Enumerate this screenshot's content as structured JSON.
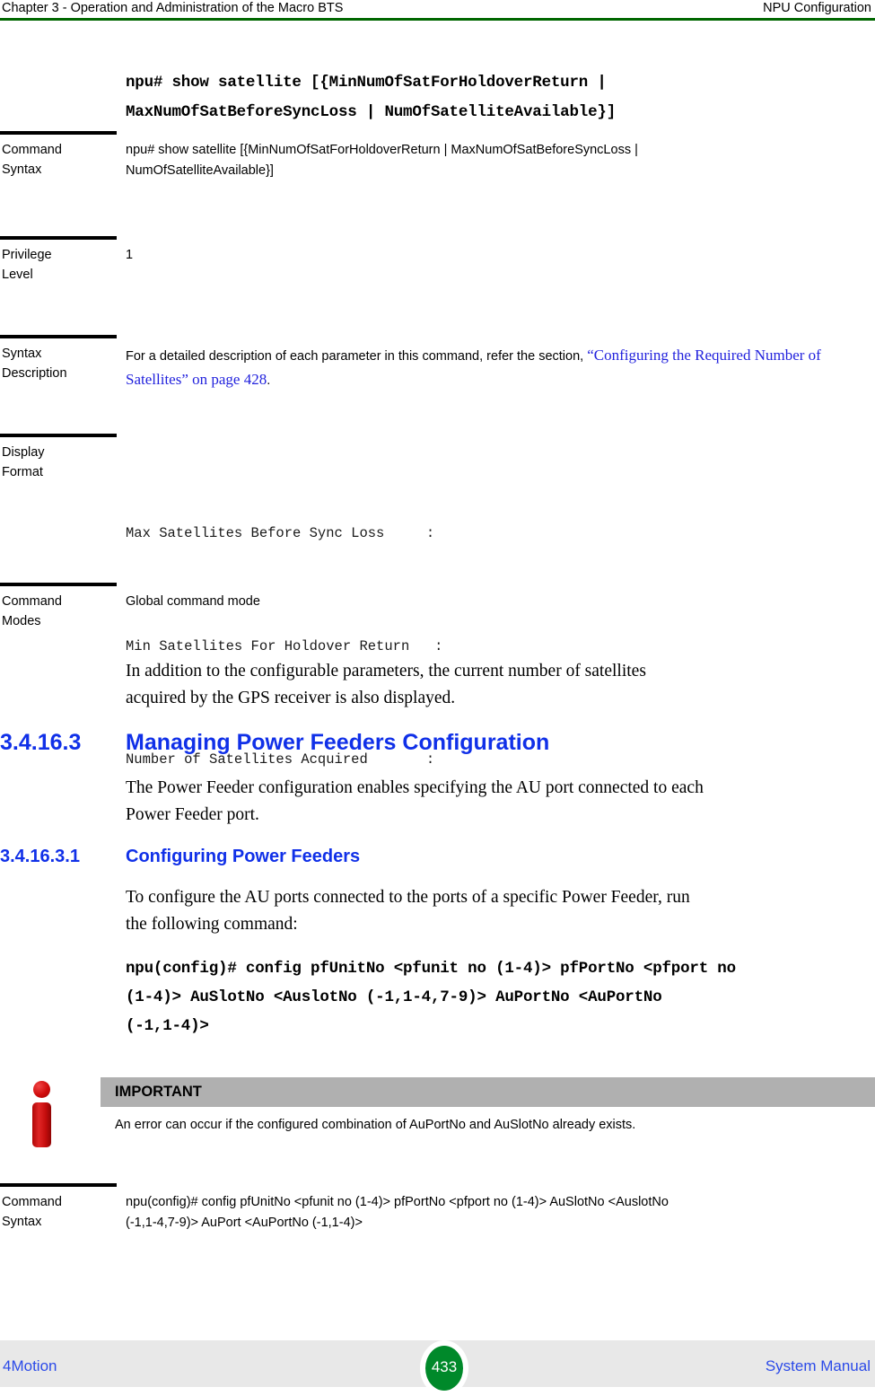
{
  "header": {
    "left": "Chapter 3 - Operation and Administration of the Macro BTS",
    "right": "NPU Configuration",
    "rule_color": "#006600"
  },
  "command_block_top": {
    "line1": "npu# show satellite [{MinNumOfSatForHoldoverReturn |",
    "line2": "MaxNumOfSatBeforeSyncLoss | NumOfSatelliteAvailable}]"
  },
  "table_show_satellite": {
    "rows": [
      {
        "label_line1": "Command",
        "label_line2": "Syntax",
        "value_line1": "npu#   show satellite [{MinNumOfSatForHoldoverReturn | MaxNumOfSatBeforeSyncLoss |",
        "value_line2": "NumOfSatelliteAvailable}]"
      },
      {
        "label_line1": "Privilege",
        "label_line2": "Level",
        "value_line1": "1",
        "value_line2": ""
      },
      {
        "label_line1": "Syntax",
        "label_line2": "Description",
        "desc_prefix": "For a detailed description of each parameter in this command, refer the section, ",
        "desc_link_line1": "“Configuring",
        "desc_link_line2": "the Required Number of Satellites” on page 428",
        "desc_suffix": "."
      },
      {
        "label_line1": "Display",
        "label_line2": "Format",
        "display_lines": [
          "Max Satellites Before Sync Loss     :",
          "Min Satellites For Holdover Return   :",
          "Number of Satellites Acquired       :"
        ]
      },
      {
        "label_line1": "Command",
        "label_line2": "Modes",
        "value_line1": "Global command mode",
        "value_line2": ""
      }
    ]
  },
  "paragraph_satellites": {
    "line1": "In addition to the configurable parameters, the current number of satellites",
    "line2": "acquired by the GPS receiver is also displayed."
  },
  "heading_3_4_16_3": {
    "number": "3.4.16.3",
    "text": "Managing Power Feeders Configuration",
    "color": "#1030e8"
  },
  "paragraph_power_feeder": {
    "line1": "The Power Feeder configuration enables specifying the AU port connected to each",
    "line2": "Power Feeder port."
  },
  "heading_3_4_16_3_1": {
    "number": "3.4.16.3.1",
    "text": "Configuring Power Feeders",
    "color": "#1030e8"
  },
  "paragraph_configure": {
    "line1": "To configure the AU ports connected to the ports of a specific Power Feeder, run",
    "line2": "the following command:"
  },
  "command_block_config": {
    "line1": "npu(config)# config pfUnitNo <pfunit no (1-4)> pfPortNo <pfport no",
    "line2": "(1-4)> AuSlotNo <AuslotNo (-1,1-4,7-9)> AuPortNo <AuPortNo",
    "line3": "(-1,1-4)>"
  },
  "important_callout": {
    "icon": "info-icon",
    "banner_label": "IMPORTANT",
    "banner_color": "#b0b0b0",
    "body": "An error can occur if the configured combination of AuPortNo and AuSlotNo already exists."
  },
  "table_config_pf": {
    "rows": [
      {
        "label_line1": "Command",
        "label_line2": "Syntax",
        "value_line1": "npu(config)# config pfUnitNo <pfunit no (1-4)> pfPortNo <pfport no (1-4)> AuSlotNo <AuslotNo",
        "value_line2": "(-1,1-4,7-9)> AuPort <AuPortNo (-1,1-4)>"
      }
    ]
  },
  "footer": {
    "left": "4Motion",
    "page_number": "433",
    "right": "System Manual",
    "badge_color": "#00892a",
    "band_color": "#e8e8e8",
    "text_color": "#2b4ae8"
  }
}
